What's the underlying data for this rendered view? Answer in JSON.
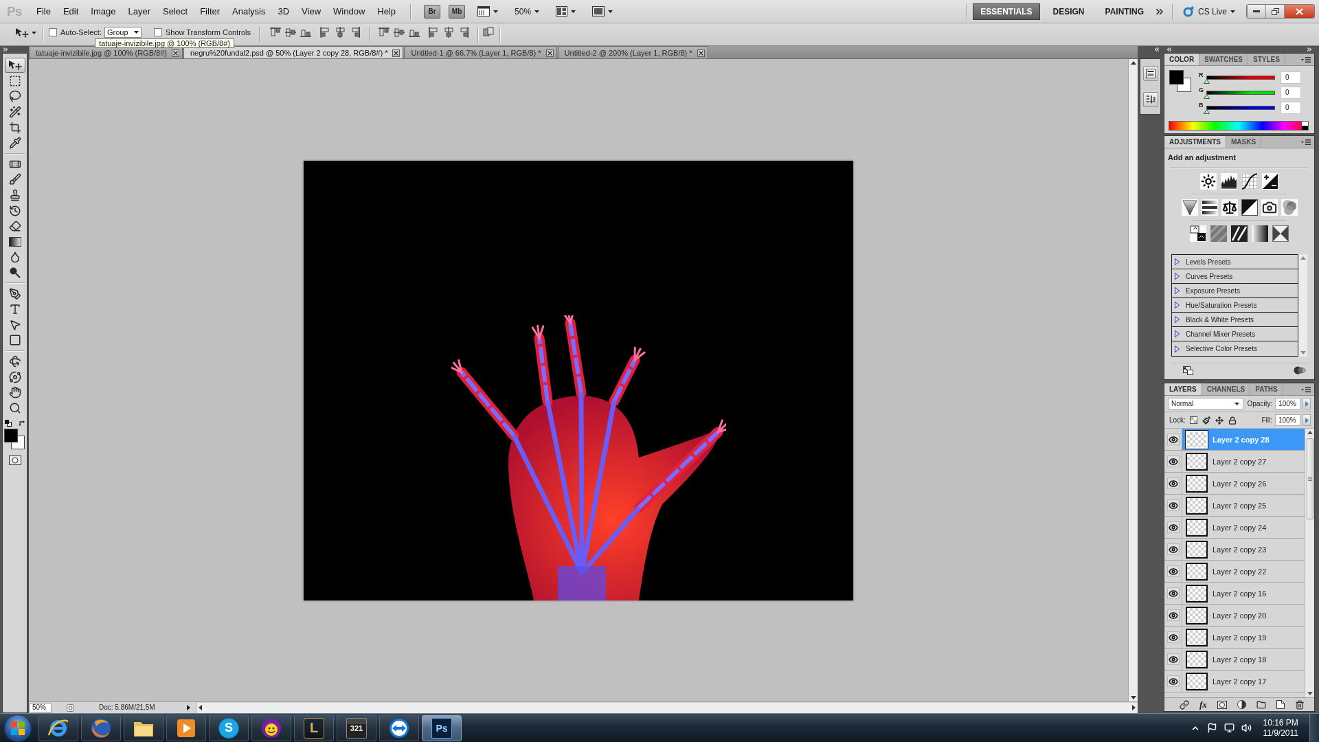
{
  "menu_bar": {
    "logo": "Ps",
    "menus": [
      "File",
      "Edit",
      "Image",
      "Layer",
      "Select",
      "Filter",
      "Analysis",
      "3D",
      "View",
      "Window",
      "Help"
    ],
    "app_buttons": [
      "Br",
      "Mb"
    ],
    "zoom": "50%",
    "workspaces": [
      {
        "label": "ESSENTIALS",
        "selected": true
      },
      {
        "label": "DESIGN",
        "selected": false
      },
      {
        "label": "PAINTING",
        "selected": false
      }
    ],
    "cs_live": "CS Live"
  },
  "options_bar": {
    "auto_select": {
      "label": "Auto-Select:",
      "checked": false,
      "value": "Group"
    },
    "transform_controls": {
      "label": "Show Transform Controls",
      "checked": false
    }
  },
  "tooltip": "tatuaje-invizibile.jpg @ 100% (RGB/8#)",
  "document_tabs": [
    {
      "label": "tatuaje-invizibile.jpg @ 100% (RGB/8#)",
      "selected": false
    },
    {
      "label": "negru%20fundal2.psd @ 50% (Layer 2 copy 28, RGB/8#) *",
      "selected": true
    },
    {
      "label": "Untitled-1 @ 66.7% (Layer 1, RGB/8) *",
      "selected": false
    },
    {
      "label": "Untitled-2 @ 200% (Layer 1, RGB/8) *",
      "selected": false
    }
  ],
  "toolbar": {
    "tool_groups": [
      [
        {
          "kind": "move",
          "selected": true
        },
        {
          "kind": "marquee",
          "selected": false
        },
        {
          "kind": "lasso",
          "selected": false
        },
        {
          "kind": "quick_selection",
          "selected": false
        },
        {
          "kind": "crop",
          "selected": false
        },
        {
          "kind": "eyedropper",
          "selected": false
        }
      ],
      [
        {
          "kind": "healing",
          "selected": false
        },
        {
          "kind": "brush",
          "selected": false
        },
        {
          "kind": "stamp",
          "selected": false
        },
        {
          "kind": "history_brush",
          "selected": false
        },
        {
          "kind": "eraser",
          "selected": false
        },
        {
          "kind": "gradient",
          "selected": false
        },
        {
          "kind": "blur",
          "selected": false
        },
        {
          "kind": "dodge",
          "selected": false
        }
      ],
      [
        {
          "kind": "pen",
          "selected": false
        },
        {
          "kind": "type",
          "selected": false
        },
        {
          "kind": "path_selection",
          "selected": false
        },
        {
          "kind": "shape",
          "selected": false
        }
      ],
      [
        {
          "kind": "rotate_3d",
          "selected": false
        },
        {
          "kind": "orbit_3d",
          "selected": false
        },
        {
          "kind": "hand",
          "selected": false
        },
        {
          "kind": "zoom",
          "selected": false
        }
      ]
    ],
    "colors": [
      {
        "kind": "foreground",
        "color": "#000000"
      },
      {
        "kind": "background",
        "color": "#ffffff"
      }
    ]
  },
  "status_bar": {
    "zoom": "50%",
    "doc_info": "Doc: 5.86M/21.5M"
  },
  "color_panel": {
    "tabs": [
      {
        "label": "COLOR",
        "selected": true
      },
      {
        "label": "SWATCHES",
        "selected": false
      },
      {
        "label": "STYLES",
        "selected": false
      }
    ],
    "swatches": [
      {
        "kind": "foreground",
        "color": "#000000"
      },
      {
        "kind": "background",
        "color": "#ffffff"
      }
    ],
    "channels": [
      {
        "name": "R",
        "level": 0,
        "value": "0",
        "color": "#e00000"
      },
      {
        "name": "G",
        "level": 0,
        "value": "0",
        "color": "#00e000"
      },
      {
        "name": "B",
        "level": 0,
        "value": "0",
        "color": "#0000e0"
      }
    ]
  },
  "adjustments_panel": {
    "tabs": [
      {
        "label": "ADJUSTMENTS",
        "selected": true
      },
      {
        "label": "MASKS",
        "selected": false
      }
    ],
    "heading": "Add an adjustment",
    "presets": [
      {
        "label": "Levels Presets",
        "expanded": false
      },
      {
        "label": "Curves Presets",
        "expanded": false
      },
      {
        "label": "Exposure Presets",
        "expanded": false
      },
      {
        "label": "Hue/Saturation Presets",
        "expanded": false
      },
      {
        "label": "Black & White Presets",
        "expanded": false
      },
      {
        "label": "Channel Mixer Presets",
        "expanded": false
      },
      {
        "label": "Selective Color Presets",
        "expanded": false
      }
    ]
  },
  "layers_panel": {
    "tabs": [
      {
        "label": "LAYERS",
        "selected": true
      },
      {
        "label": "CHANNELS",
        "selected": false
      },
      {
        "label": "PATHS",
        "selected": false
      }
    ],
    "blend_mode": "Normal",
    "opacity_label": "Opacity:",
    "opacity": "100%",
    "lock_label": "Lock:",
    "fill_label": "Fill:",
    "fill": "100%",
    "layers": [
      {
        "name": "Layer 2 copy 28",
        "visible": true,
        "selected": true
      },
      {
        "name": "Layer 2 copy 27",
        "visible": true,
        "selected": false
      },
      {
        "name": "Layer 2 copy 26",
        "visible": true,
        "selected": false
      },
      {
        "name": "Layer 2 copy 25",
        "visible": true,
        "selected": false
      },
      {
        "name": "Layer 2 copy 24",
        "visible": true,
        "selected": false
      },
      {
        "name": "Layer 2 copy 23",
        "visible": true,
        "selected": false
      },
      {
        "name": "Layer 2 copy 22",
        "visible": true,
        "selected": false
      },
      {
        "name": "Layer 2 copy 16",
        "visible": true,
        "selected": false
      },
      {
        "name": "Layer 2 copy 20",
        "visible": true,
        "selected": false
      },
      {
        "name": "Layer 2 copy 19",
        "visible": true,
        "selected": false
      },
      {
        "name": "Layer 2 copy 18",
        "visible": true,
        "selected": false
      },
      {
        "name": "Layer 2 copy 17",
        "visible": true,
        "selected": false
      }
    ],
    "footer_fx": "fx"
  },
  "taskbar": {
    "apps": [
      {
        "kind": "ie",
        "selected": false
      },
      {
        "kind": "firefox",
        "selected": false
      },
      {
        "kind": "explorer",
        "selected": false
      },
      {
        "kind": "media_player",
        "selected": false
      },
      {
        "kind": "skype",
        "glyph": "S",
        "selected": false
      },
      {
        "kind": "messenger",
        "selected": false
      },
      {
        "kind": "league",
        "glyph": "L",
        "selected": false
      },
      {
        "kind": "video",
        "glyph": "321",
        "selected": false
      },
      {
        "kind": "teamviewer",
        "selected": false
      },
      {
        "kind": "photoshop",
        "glyph": "Ps",
        "selected": true
      }
    ],
    "clock": {
      "time": "10:16 PM",
      "date": "11/9/2011"
    }
  }
}
